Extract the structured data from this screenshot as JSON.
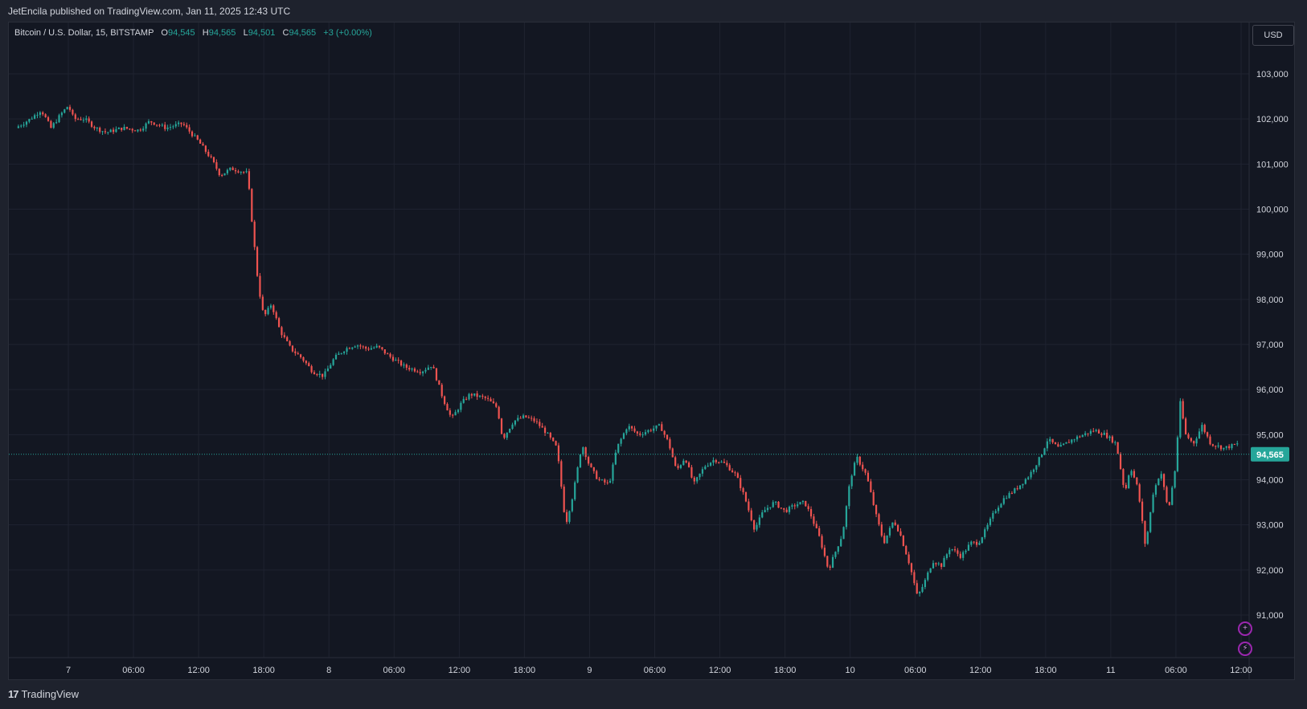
{
  "header": {
    "published_text": "JetEncila published on TradingView.com, Jan 11, 2025 12:43 UTC"
  },
  "legend": {
    "symbol": "Bitcoin / U.S. Dollar, 15, BITSTAMP",
    "open_label": "O",
    "open": "94,545",
    "high_label": "H",
    "high": "94,565",
    "low_label": "L",
    "low": "94,501",
    "close_label": "C",
    "close": "94,565",
    "change": "+3 (+0.00%)"
  },
  "currency": "USD",
  "footer": {
    "brand": "TradingView"
  },
  "colors": {
    "up": "#26a69a",
    "down": "#ef5350",
    "grid": "#1f2330",
    "background": "#131722",
    "text": "#d1d4dc",
    "price_tag": "#26a69a"
  },
  "chart_data": {
    "type": "candlestick",
    "interval_minutes": 15,
    "ylim": [
      90000,
      103800
    ],
    "y_ticks": [
      91000,
      92000,
      93000,
      94000,
      95000,
      96000,
      97000,
      98000,
      99000,
      100000,
      101000,
      102000,
      103000
    ],
    "y_tick_labels": [
      "91,000",
      "92,000",
      "93,000",
      "94,000",
      "95,000",
      "96,000",
      "97,000",
      "98,000",
      "99,000",
      "100,000",
      "101,000",
      "102,000",
      "103,000"
    ],
    "x_range_hours": [
      -4.85,
      90.2
    ],
    "x_ticks": [
      {
        "label": "7",
        "hour": 0
      },
      {
        "label": "06:00",
        "hour": 6
      },
      {
        "label": "12:00",
        "hour": 12
      },
      {
        "label": "18:00",
        "hour": 18
      },
      {
        "label": "8",
        "hour": 24
      },
      {
        "label": "06:00",
        "hour": 30
      },
      {
        "label": "12:00",
        "hour": 36
      },
      {
        "label": "18:00",
        "hour": 42
      },
      {
        "label": "9",
        "hour": 48
      },
      {
        "label": "06:00",
        "hour": 54
      },
      {
        "label": "12:00",
        "hour": 60
      },
      {
        "label": "18:00",
        "hour": 66
      },
      {
        "label": "10",
        "hour": 72
      },
      {
        "label": "06:00",
        "hour": 78
      },
      {
        "label": "12:00",
        "hour": 84
      },
      {
        "label": "18:00",
        "hour": 90
      },
      {
        "label": "11",
        "hour": 96
      },
      {
        "label": "06:00",
        "hour": 102
      },
      {
        "label": "12:00",
        "hour": 108
      }
    ],
    "last_price": 94565,
    "last_price_label": "94,565",
    "close_path": [
      [
        -4.85,
        101800
      ],
      [
        -3.5,
        102000
      ],
      [
        -2.5,
        102200
      ],
      [
        -1.6,
        101800
      ],
      [
        -0.7,
        102100
      ],
      [
        0,
        102300
      ],
      [
        0.5,
        102000
      ],
      [
        1.5,
        102000
      ],
      [
        2.5,
        101800
      ],
      [
        3.5,
        101700
      ],
      [
        5,
        101800
      ],
      [
        6.5,
        101750
      ],
      [
        7.5,
        101950
      ],
      [
        9,
        101800
      ],
      [
        10.5,
        101900
      ],
      [
        12,
        101500
      ],
      [
        13.2,
        101100
      ],
      [
        14,
        100750
      ],
      [
        15,
        100900
      ],
      [
        16.5,
        100800
      ],
      [
        17,
        99500
      ],
      [
        17.5,
        98300
      ],
      [
        18,
        97600
      ],
      [
        18.7,
        97900
      ],
      [
        19.5,
        97300
      ],
      [
        20.5,
        96900
      ],
      [
        21.5,
        96700
      ],
      [
        22.5,
        96400
      ],
      [
        23.5,
        96300
      ],
      [
        24.5,
        96700
      ],
      [
        25.5,
        96900
      ],
      [
        26.5,
        97000
      ],
      [
        27.5,
        96900
      ],
      [
        28.5,
        96950
      ],
      [
        29.5,
        96750
      ],
      [
        31,
        96500
      ],
      [
        32.5,
        96400
      ],
      [
        33.5,
        96550
      ],
      [
        34.5,
        95800
      ],
      [
        35.3,
        95350
      ],
      [
        36.2,
        95700
      ],
      [
        37,
        95900
      ],
      [
        38.5,
        95800
      ],
      [
        39.5,
        95600
      ],
      [
        40,
        94900
      ],
      [
        41,
        95300
      ],
      [
        42,
        95400
      ],
      [
        43,
        95300
      ],
      [
        44,
        95050
      ],
      [
        45,
        94700
      ],
      [
        45.8,
        93000
      ],
      [
        46.5,
        93700
      ],
      [
        47.3,
        94800
      ],
      [
        48,
        94300
      ],
      [
        48.8,
        94000
      ],
      [
        49.8,
        93900
      ],
      [
        50.5,
        94700
      ],
      [
        51.5,
        95200
      ],
      [
        52.5,
        95000
      ],
      [
        53.5,
        95100
      ],
      [
        54.5,
        95200
      ],
      [
        55.3,
        94800
      ],
      [
        56,
        94200
      ],
      [
        56.8,
        94500
      ],
      [
        57.6,
        93900
      ],
      [
        58.6,
        94300
      ],
      [
        59.5,
        94450
      ],
      [
        60.5,
        94350
      ],
      [
        61.5,
        94100
      ],
      [
        62.3,
        93600
      ],
      [
        63.2,
        92900
      ],
      [
        64,
        93300
      ],
      [
        65,
        93500
      ],
      [
        66,
        93300
      ],
      [
        67,
        93450
      ],
      [
        67.8,
        93500
      ],
      [
        68.4,
        93200
      ],
      [
        69.2,
        92700
      ],
      [
        70,
        92000
      ],
      [
        70.8,
        92500
      ],
      [
        71.3,
        92800
      ],
      [
        72,
        94000
      ],
      [
        72.6,
        94500
      ],
      [
        73.5,
        94100
      ],
      [
        74.4,
        93200
      ],
      [
        75.1,
        92600
      ],
      [
        76,
        93100
      ],
      [
        76.6,
        92800
      ],
      [
        77.5,
        92100
      ],
      [
        78.2,
        91400
      ],
      [
        78.8,
        91700
      ],
      [
        79.6,
        92200
      ],
      [
        80.4,
        92100
      ],
      [
        81.2,
        92500
      ],
      [
        82.2,
        92300
      ],
      [
        83.1,
        92600
      ],
      [
        83.8,
        92600
      ],
      [
        84.5,
        92900
      ],
      [
        85.3,
        93300
      ],
      [
        86.2,
        93600
      ],
      [
        87.3,
        93800
      ],
      [
        88.5,
        94100
      ],
      [
        89.5,
        94500
      ],
      [
        90.2,
        94900
      ],
      [
        91.2,
        94700
      ],
      [
        92.5,
        94900
      ],
      [
        93.5,
        95000
      ],
      [
        94.5,
        95100
      ],
      [
        95.5,
        95000
      ],
      [
        96.5,
        94800
      ],
      [
        97.3,
        93700
      ],
      [
        97.8,
        94300
      ],
      [
        98.5,
        93800
      ],
      [
        99.2,
        92500
      ],
      [
        99.9,
        93700
      ],
      [
        100.6,
        94200
      ],
      [
        101.3,
        93300
      ],
      [
        101.9,
        94200
      ],
      [
        102.4,
        95700
      ],
      [
        102.9,
        95000
      ],
      [
        103.6,
        94800
      ],
      [
        104.4,
        95200
      ],
      [
        105.2,
        94800
      ],
      [
        106.4,
        94700
      ],
      [
        107.8,
        94800
      ]
    ]
  }
}
